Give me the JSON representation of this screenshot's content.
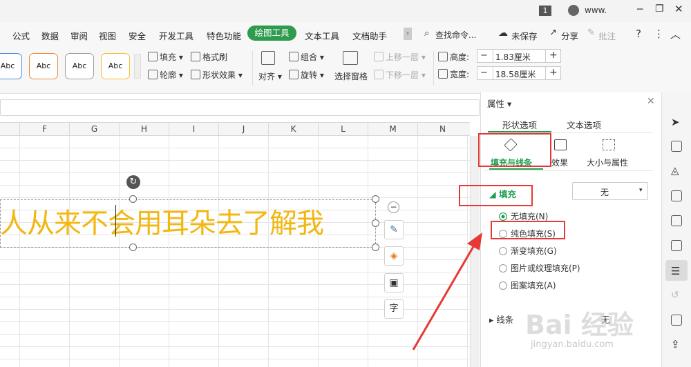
{
  "titlebar": {
    "tab_count": "1",
    "user_name": "www."
  },
  "menu": {
    "items": [
      "公式",
      "数据",
      "审阅",
      "视图",
      "安全",
      "开发工具",
      "特色功能",
      "绘图工具",
      "文本工具",
      "文档助手"
    ],
    "active": "绘图工具",
    "search": "查找命令...",
    "unsaved": "未保存",
    "share": "分享",
    "comment": "批注",
    "help": "?"
  },
  "ribbon": {
    "style_chips": [
      "Abc",
      "Abc",
      "Abc",
      "Abc"
    ],
    "fill": "填充",
    "format_painter": "格式刷",
    "outline": "轮廓",
    "shape_effects": "形状效果",
    "align": "对齐",
    "group": "组合",
    "rotate": "旋转",
    "selection_pane": "选择窗格",
    "bring_forward": "上移一层",
    "send_backward": "下移一层",
    "height_label": "高度:",
    "height_value": "1.83厘米",
    "width_label": "宽度:",
    "width_value": "18.58厘米",
    "minus": "−",
    "plus": "+"
  },
  "sheet": {
    "columns": [
      "F",
      "G",
      "H",
      "I",
      "J",
      "K",
      "L",
      "M",
      "N"
    ],
    "textbox_text": "人从来不会用耳朵去了解我",
    "float_buttons": [
      "−",
      "✎",
      "◈",
      "▣",
      "字"
    ]
  },
  "panel": {
    "title": "属性",
    "tab_shape": "形状选项",
    "tab_text": "文本选项",
    "sub_fill_line": "填充与线条",
    "sub_effects": "效果",
    "sub_size": "大小与属性",
    "fill_section": "填充",
    "fill_dropdown": "无",
    "options": [
      {
        "label": "无填充(N)",
        "checked": true
      },
      {
        "label": "纯色填充(S)",
        "checked": false
      },
      {
        "label": "渐变填充(G)",
        "checked": false
      },
      {
        "label": "图片或纹理填充(P)",
        "checked": false
      },
      {
        "label": "图案填充(A)",
        "checked": false
      }
    ],
    "line_section": "线条",
    "line_value": "无"
  },
  "watermark": {
    "brand": "Bai 经验",
    "url": "jingyan.baidu.com"
  },
  "colors": {
    "accent": "#2e9b4e",
    "text_yellow": "#f2b811",
    "annotation_red": "#e53935"
  }
}
